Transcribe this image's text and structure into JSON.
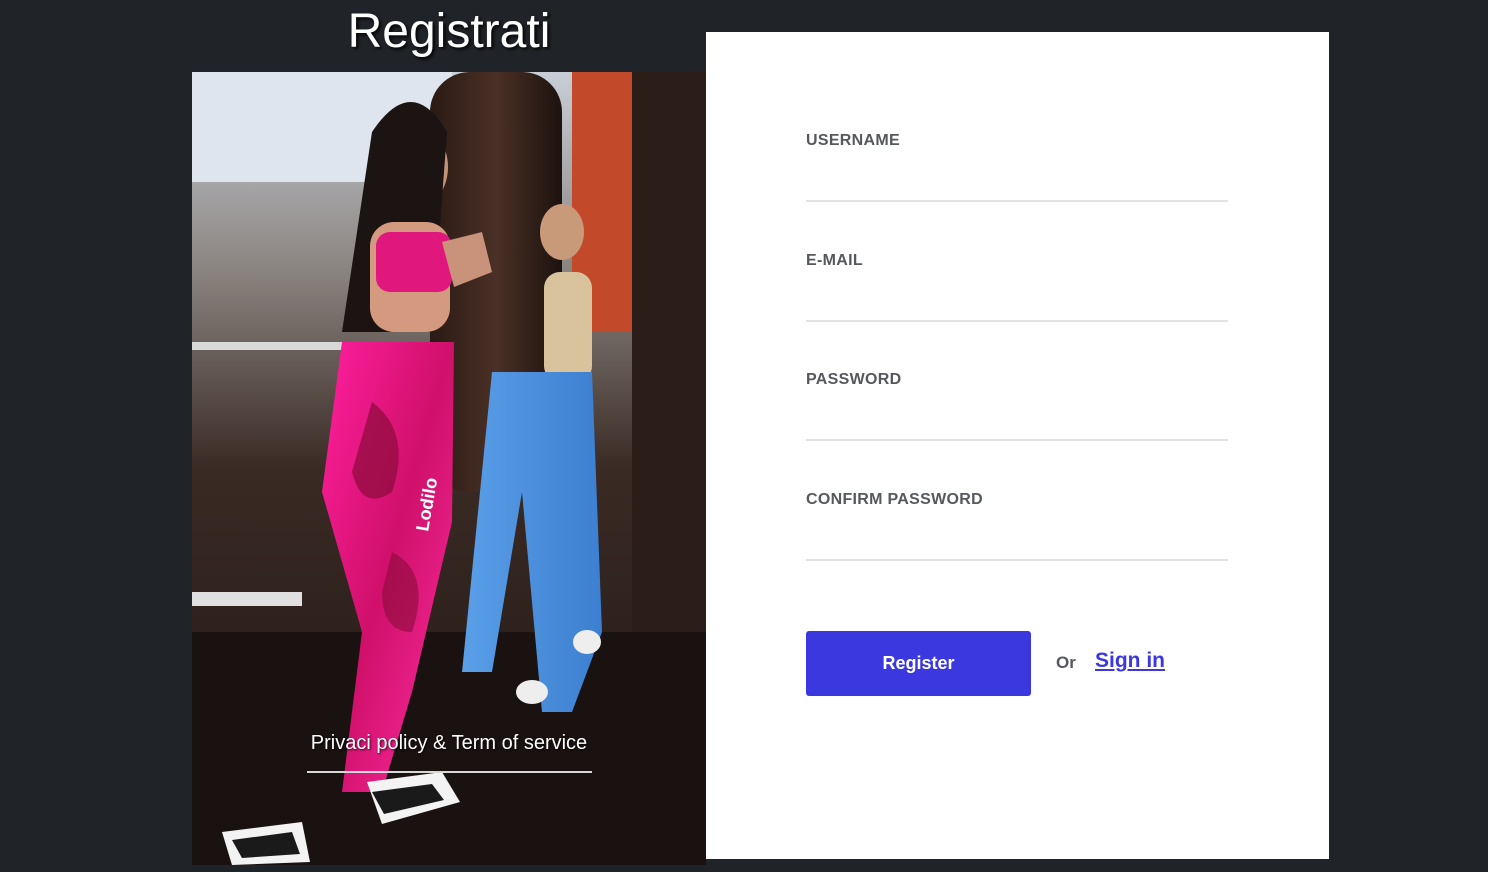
{
  "page": {
    "title": "Registrati"
  },
  "photo": {
    "icon": "fitness-photo",
    "brand_text": "Lodilo",
    "policy_link": "Privaci policy & Term of service"
  },
  "form": {
    "fields": [
      {
        "label": "USERNAME",
        "value": "",
        "placeholder": ""
      },
      {
        "label": "E-MAIL",
        "value": "",
        "placeholder": ""
      },
      {
        "label": "PASSWORD",
        "value": "",
        "placeholder": ""
      },
      {
        "label": "CONFIRM PASSWORD",
        "value": "",
        "placeholder": ""
      }
    ],
    "register_label": "Register",
    "or_label": "Or",
    "signin_label": "Sign in"
  },
  "colors": {
    "background": "#202328",
    "accent": "#3b38e0",
    "label": "#55585d",
    "underline": "#e2e2e2"
  }
}
